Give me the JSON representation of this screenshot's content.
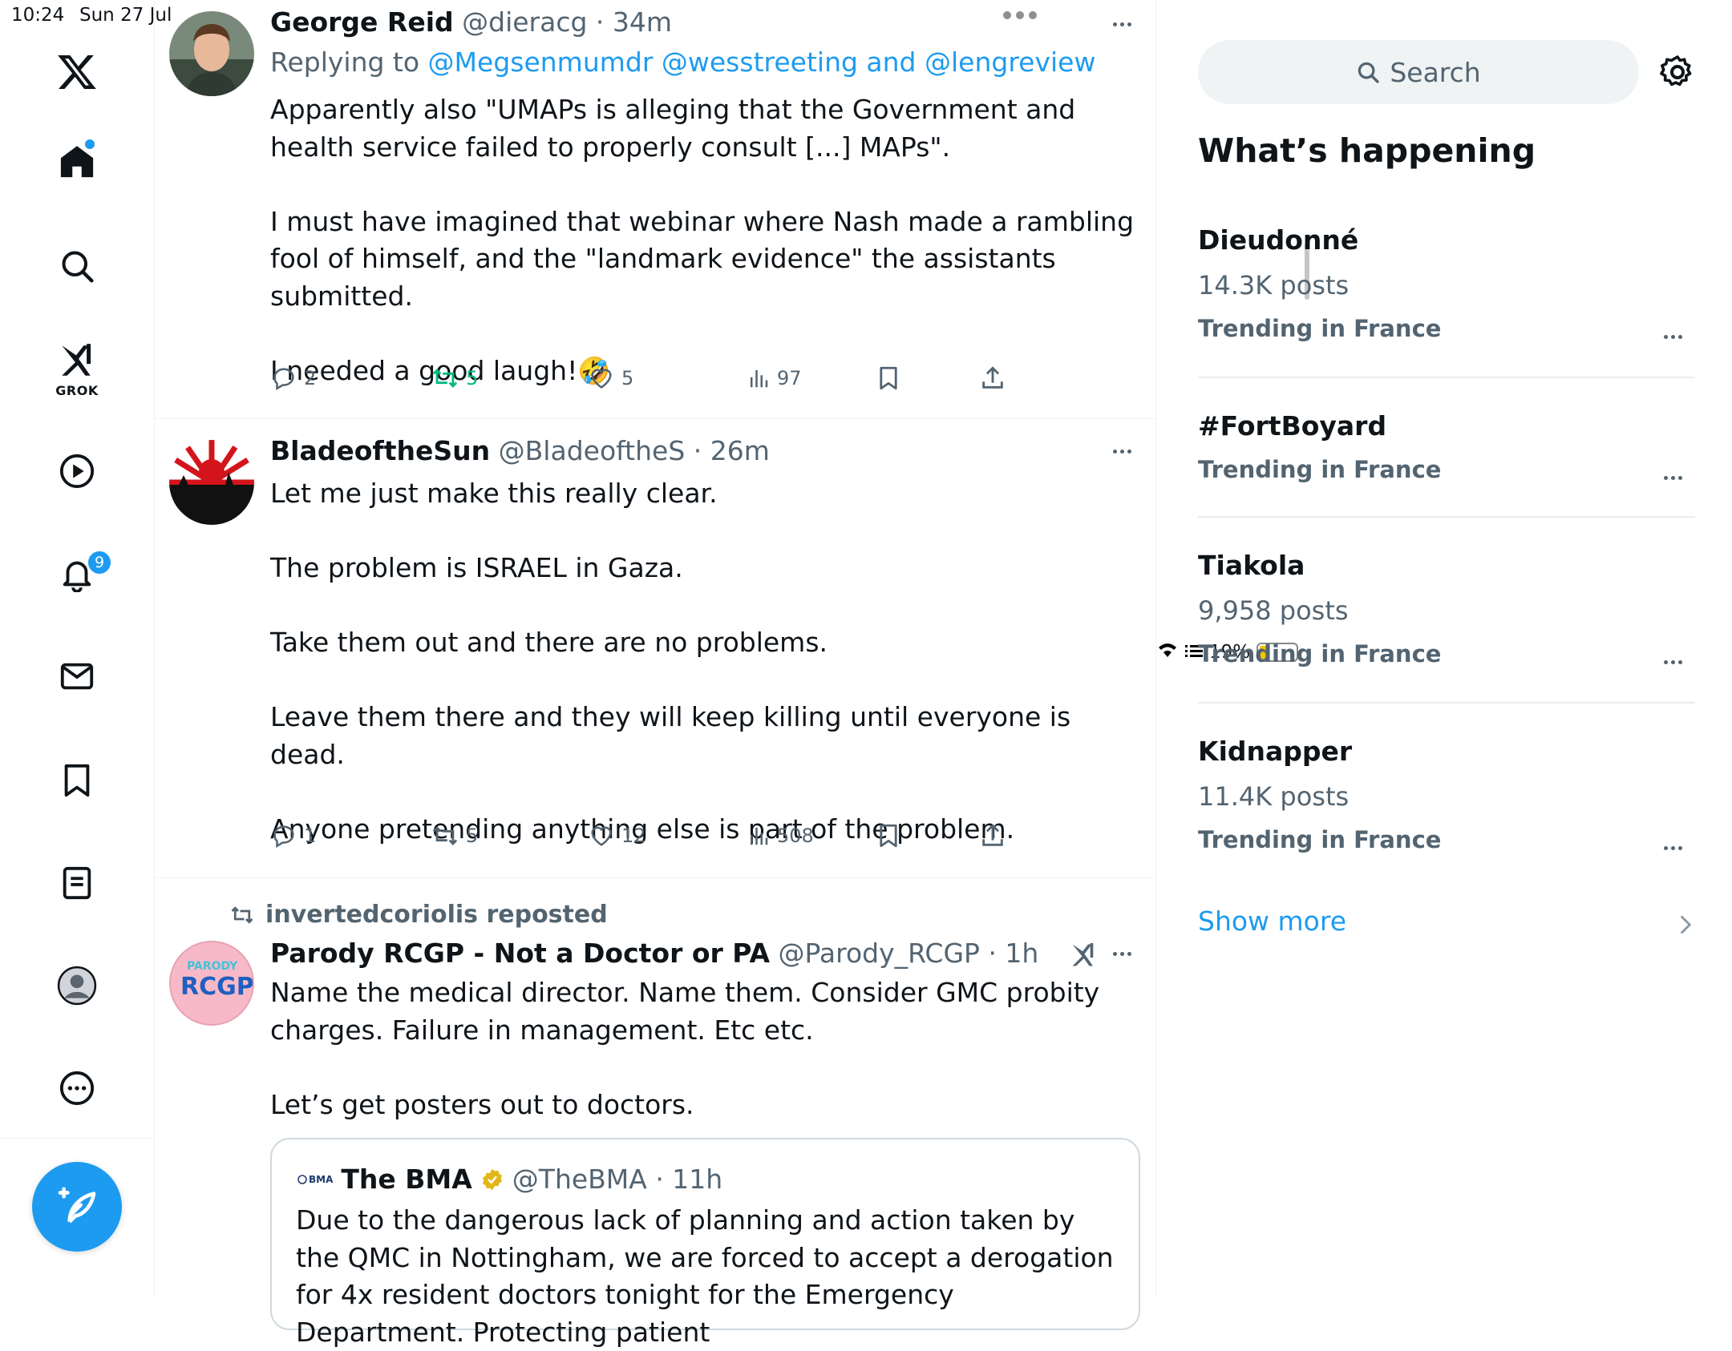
{
  "status_bar": {
    "time": "10:24",
    "date": "Sun 27 Jul",
    "battery": "19%"
  },
  "nav": {
    "grok_label": "GROK",
    "notifications_badge": "9"
  },
  "posts": [
    {
      "name": "George Reid",
      "meta": "@dieracg · 34m",
      "replying_prefix": "Replying to",
      "replying_links": "@Megsenmumdr @wesstreeting and @lengreview",
      "paragraphs": [
        "Apparently also \"UMAPs is alleging that the Government and health service failed to properly consult [...] MAPs\".",
        "I must have imagined that webinar where Nash made a rambling fool of himself, and the \"landmark evidence\" the assistants submitted.",
        "I needed a good laugh!🤣"
      ],
      "replies": "2",
      "reposts": "5",
      "likes": "5",
      "views": "97"
    },
    {
      "name": "BladeoftheSun",
      "meta": "@BladeoftheS · 26m",
      "paragraphs": [
        "Let me just make this really clear.",
        "The problem is ISRAEL in Gaza.",
        "Take them out and there are no problems.",
        "Leave them there and they will keep killing until everyone is dead.",
        "Anyone pretending anything else is part of the problem."
      ],
      "replies": "1",
      "reposts": "5",
      "likes": "12",
      "views": "508"
    },
    {
      "reposted_by": "invertedcoriolis reposted",
      "name": "Parody RCGP - Not a Doctor or PA",
      "meta": "@Parody_RCGP · 1h",
      "avatar_text_top": "PARODY",
      "avatar_text_main": "RCGP",
      "paragraphs": [
        "Name the medical director. Name them. Consider GMC probity charges. Failure in management. Etc etc.",
        "Let’s get posters out to doctors."
      ],
      "quote": {
        "logo": "BMA",
        "name": "The BMA",
        "meta": "@TheBMA · 11h",
        "text": "Due to the dangerous lack of planning and action taken by the QMC in Nottingham, we are forced to accept a derogation for 4x resident doctors tonight for the Emergency Department. Protecting patient"
      }
    }
  ],
  "sidebar": {
    "search_placeholder": "Search",
    "title": "What’s happening",
    "trends": [
      {
        "name": "Dieudonné",
        "count": "14.3K posts",
        "context": "Trending in France"
      },
      {
        "name": "#FortBoyard",
        "count": "",
        "context": "Trending in France"
      },
      {
        "name": "Tiakola",
        "count": "9,958 posts",
        "context": "Trending in France"
      },
      {
        "name": "Kidnapper",
        "count": "11.4K posts",
        "context": "Trending in France"
      }
    ],
    "show_more": "Show more"
  },
  "colors": {
    "accent": "#1d9bf0",
    "repost_active": "#00ba7c",
    "secondary_text": "#536471"
  }
}
